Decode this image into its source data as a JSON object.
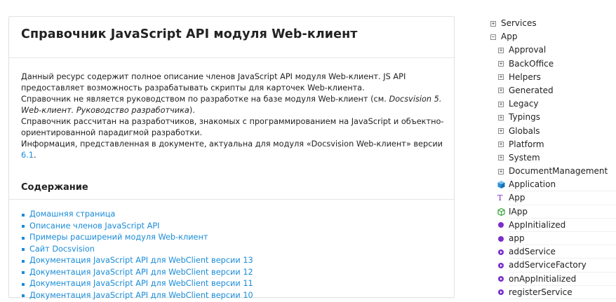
{
  "panel": {
    "title": "Справочник JavaScript API модуля Web-клиент",
    "desc": {
      "line1": "Данный ресурс содержит полное описание членов JavaScript API модуля Web-клиент. JS API предоставляет возможность разрабатывать скрипты для карточек Web-клиента.",
      "line2_pre": "Справочник не является руководством по разработке на базе модуля Web-клиент (см. ",
      "line2_em": "Docsvision 5. Web-клиент. Руководство разработчика",
      "line2_post": ").",
      "line3": "Справочник рассчитан на разработчиков, знакомых с программированием на JavaScript и объектно-ориентированной парадигмой разработки.",
      "line4_pre": "Информация, представленная в документе, актуальна для модуля «Docsvision Web-клиент» версии ",
      "line4_ver": "6.1",
      "line4_post": "."
    },
    "toc_heading": "Содержание",
    "toc": [
      "Домашняя страница",
      "Описание членов JavaScript API",
      "Примеры расширений модуля Web-клиент",
      "Сайт Docsvision",
      "Документация JavaScript API для WebClient версии 13",
      "Документация JavaScript API для WebClient версии 12",
      "Документация JavaScript API для WebClient версии 11",
      "Документация JavaScript API для WebClient версии 10"
    ]
  },
  "tree": {
    "services": "Services",
    "app": "App",
    "children": [
      "Approval",
      "BackOffice",
      "Helpers",
      "Generated",
      "Legacy",
      "Typings",
      "Globals",
      "Platform",
      "System",
      "DocumentManagement"
    ],
    "members": {
      "application": "Application",
      "app_type": "App",
      "iapp": "IApp",
      "app_initialized": "AppInitialized",
      "app_var": "app",
      "add_service": "addService",
      "add_service_factory": "addServiceFactory",
      "on_app_initialized": "onAppInitialized",
      "register_service": "registerService"
    },
    "icon_colors": {
      "class": "#2a8fd6",
      "type": "#7a2ec9",
      "interface": "#3aa23a",
      "function": "#7a2ec9"
    }
  }
}
